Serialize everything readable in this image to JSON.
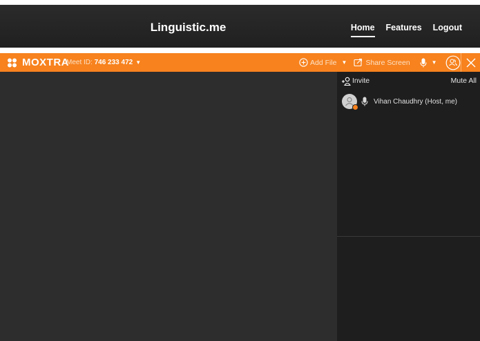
{
  "site": {
    "title": "Linguistic.me",
    "nav": [
      {
        "label": "Home",
        "active": true
      },
      {
        "label": "Features",
        "active": false
      },
      {
        "label": "Logout",
        "active": false
      }
    ]
  },
  "moxtra": {
    "brand": "MOXTRA",
    "meet_id_label": "Meet ID:",
    "meet_id_value": "746 233 472",
    "add_file_label": "Add File",
    "share_screen_label": "Share Screen",
    "icons": [
      "logo-icon",
      "plus-circle-icon",
      "share-screen-icon",
      "microphone-icon",
      "participants-icon",
      "close-icon",
      "caret-down-icon"
    ]
  },
  "sidebar": {
    "invite_label": "Invite",
    "mute_all_label": "Mute All",
    "participants": [
      {
        "name": "Vihan Chaudhry (Host, me)"
      }
    ]
  },
  "colors": {
    "accent": "#f7821e",
    "header_bg": "#252525",
    "stage_bg": "#2d2d2d",
    "sidebar_bg": "#1e1e1e"
  }
}
